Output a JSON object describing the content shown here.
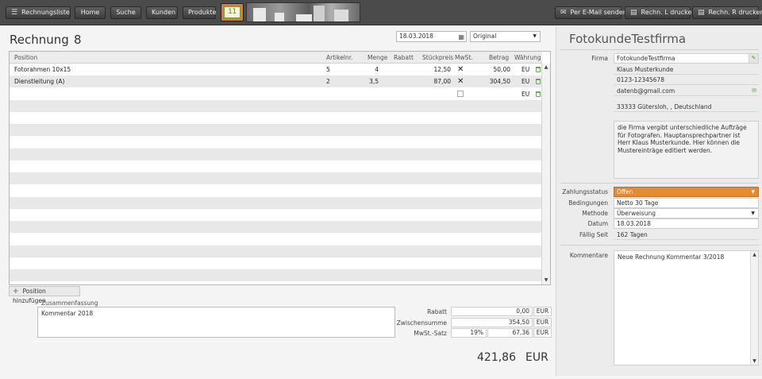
{
  "toolbar": {
    "buttons": {
      "rechnungsliste": "Rechnungsliste",
      "home": "Home",
      "suche": "Suche",
      "kunden": "Kunden",
      "produkte": "Produkte"
    },
    "calendar_day": "11",
    "email_button": "Per E-Mail senden",
    "print_l": "Rechn. L drucken",
    "print_r": "Rechn. R drucken"
  },
  "invoice": {
    "title": "Rechnung",
    "number": "8",
    "date": "18.03.2018",
    "version": "Original"
  },
  "grid": {
    "columns": [
      "Position",
      "Artikelnr.",
      "Menge",
      "Rabatt",
      "Stückpreis",
      "MwSt.",
      "Betrag",
      "Währung"
    ],
    "rows": [
      {
        "position": "Fotorahmen 10x15",
        "artikelnr": "5",
        "menge": "4",
        "rabatt": "",
        "stueckpreis": "12,50",
        "mwst": true,
        "betrag": "50,00",
        "waehrung": "EU"
      },
      {
        "position": "Dienstleitung (A)",
        "artikelnr": "2",
        "menge": "3,5",
        "rabatt": "",
        "stueckpreis": "87,00",
        "mwst": true,
        "betrag": "304,50",
        "waehrung": "EU"
      },
      {
        "position": "",
        "artikelnr": "",
        "menge": "",
        "rabatt": "",
        "stueckpreis": "",
        "mwst": false,
        "betrag": "",
        "waehrung": "EU"
      }
    ],
    "add_label": "Position hinzufügen"
  },
  "summary": {
    "label": "Zusammenfassung",
    "text": "Kommentar 2018"
  },
  "totals": {
    "rabatt_label": "Rabatt",
    "rabatt_value": "0,00",
    "zwischensumme_label": "Zwischensumme",
    "zwischensumme_value": "354,50",
    "mwst_label": "MwSt.-Satz",
    "mwst_rate": "19%",
    "mwst_value": "67,36",
    "currency": "EUR",
    "total": "421,86"
  },
  "customer": {
    "title": "FotokundeTestfirma",
    "firma_label": "Firma",
    "firma": "FotokundeTestfirma",
    "contact": "Klaus Musterkunde",
    "phone": "0123-12345678",
    "email": "datenb@gmail.com",
    "address": "33333 Gütersloh, , Deutschland",
    "note": "die Firma vergibt unterschiedliche Aufträge für Fotografen. Hauptansprechpartner ist Herr Klaus Musterkunde. Hier können die Mustereinträge editiert werden."
  },
  "payment": {
    "status_label": "Zahlungsstatus",
    "status": "Offen",
    "status_color": "#e78a2f",
    "bedingungen_label": "Bedingungen",
    "bedingungen": "Netto 30 Tage",
    "methode_label": "Methode",
    "methode": "Überweisung",
    "datum_label": "Datum",
    "datum": "18.03.2018",
    "faellig_label": "Fällig Seit",
    "faellig": "162 Tagen"
  },
  "kommentare": {
    "label": "Kommentare",
    "text": "Neue Rechnung Kommentar 3/2018"
  },
  "colors": {
    "accent_green": "#5a9b31",
    "toolbar_bg": "#4b4b4b"
  }
}
